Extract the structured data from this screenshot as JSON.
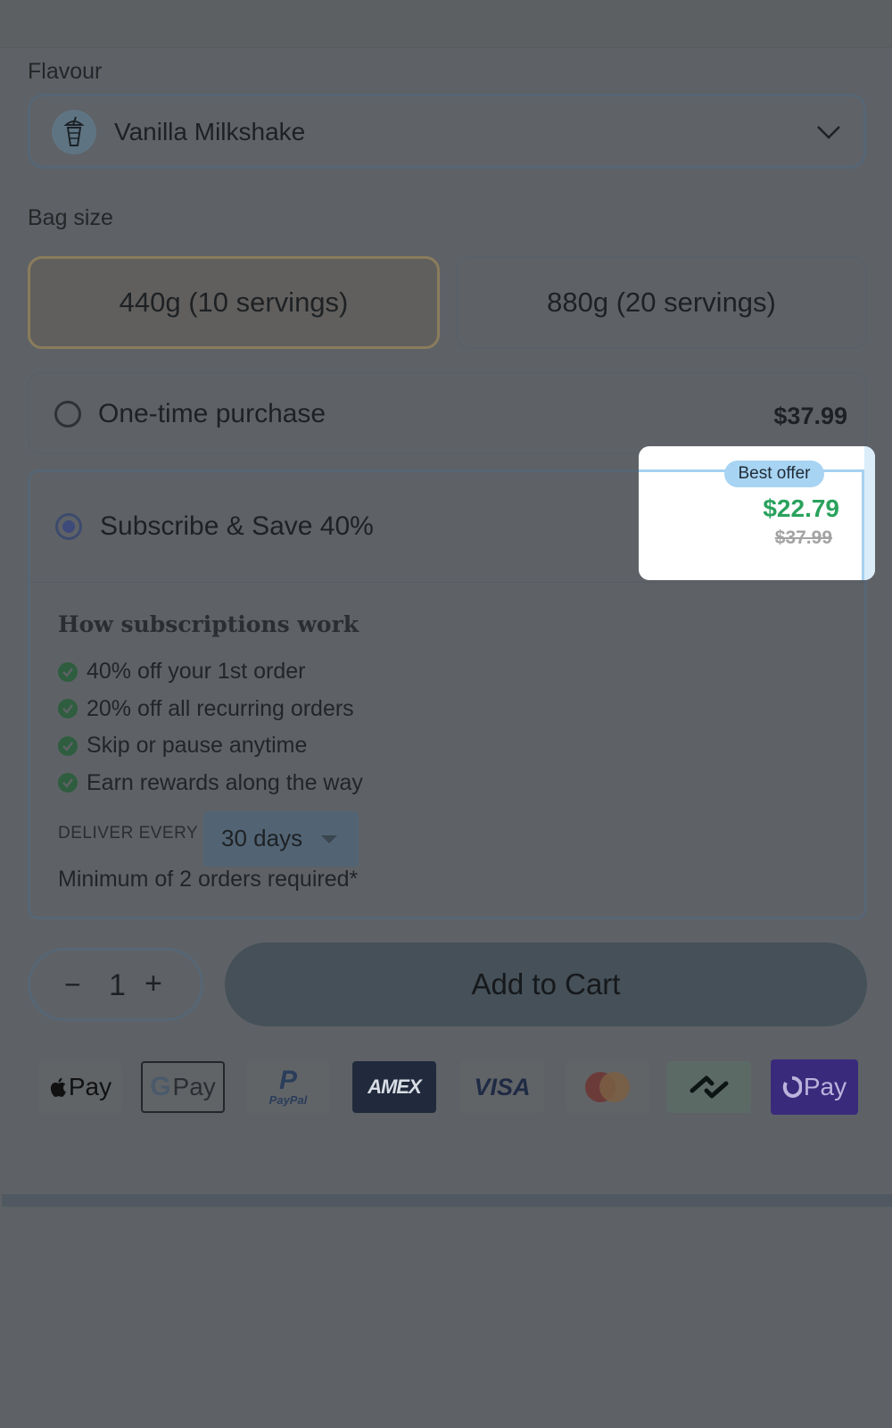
{
  "flavour": {
    "label": "Flavour",
    "selected": "Vanilla Milkshake"
  },
  "bag_size": {
    "label": "Bag size",
    "options": [
      {
        "label": "440g (10 servings)",
        "selected": true
      },
      {
        "label": "880g (20 servings)",
        "selected": false
      }
    ]
  },
  "one_time": {
    "label": "One-time purchase",
    "price": "$37.99"
  },
  "subscribe": {
    "label": "Subscribe & Save 40%",
    "badge": "Best offer",
    "sale_price": "$22.79",
    "original_price": "$37.99",
    "how_title": "How subscriptions work",
    "benefits": [
      "40% off your 1st order",
      "20% off all recurring orders",
      "Skip or pause anytime",
      "Earn rewards along the way"
    ],
    "deliver_label": "DELIVER EVERY",
    "deliver_value": "30 days",
    "minimum_note": "Minimum of 2 orders required*"
  },
  "cart": {
    "quantity": "1",
    "minus": "−",
    "plus": "+",
    "add_label": "Add to Cart"
  },
  "payments": {
    "apple": "Pay",
    "gpay": "Pay",
    "paypal": "PayPal",
    "amex": "AMEX",
    "visa": "VISA",
    "opay": "Pay"
  },
  "colors": {
    "accent_green": "#2aa25d",
    "badge_blue": "#a8d4f3",
    "overlay": "#5e6266"
  }
}
